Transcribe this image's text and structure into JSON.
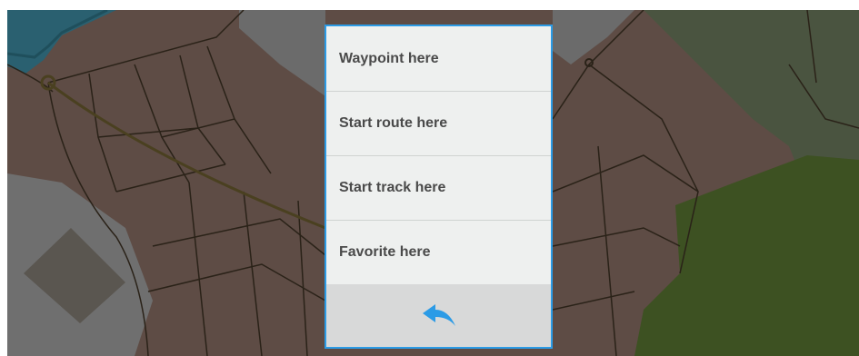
{
  "map": {
    "background_color": "#5e4c45",
    "water_color": "#2a6070",
    "park_color": "#3d5122",
    "road_color": "#2a2218"
  },
  "context_menu": {
    "border_color": "#2b9be6",
    "items": [
      {
        "label": "Waypoint here"
      },
      {
        "label": "Start route here"
      },
      {
        "label": "Start track here"
      },
      {
        "label": "Favorite here"
      }
    ],
    "back_button": {
      "icon": "back-arrow-icon",
      "color": "#2b9be6"
    }
  }
}
